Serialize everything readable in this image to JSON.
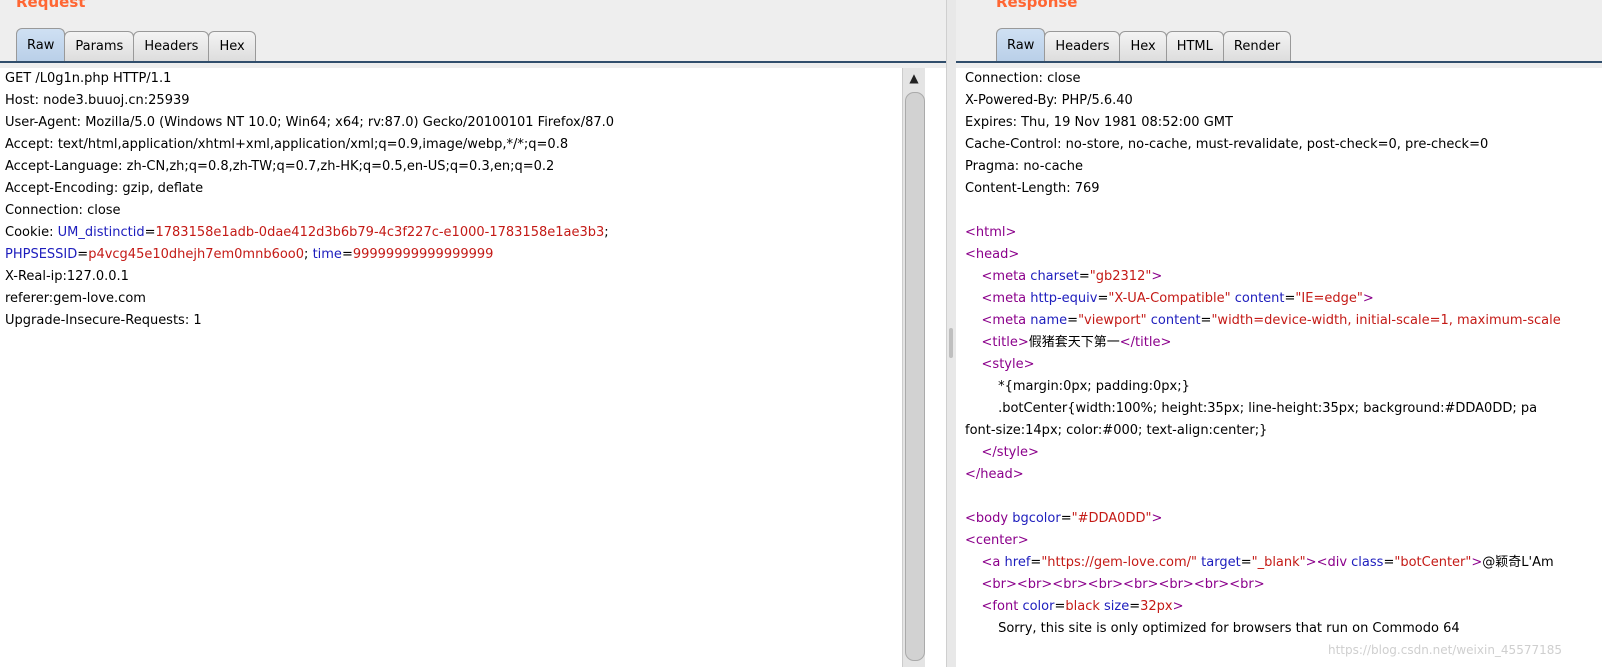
{
  "request": {
    "title": "Request",
    "tabs": [
      "Raw",
      "Params",
      "Headers",
      "Hex"
    ],
    "lines": [
      "GET /L0g1n.php HTTP/1.1",
      "Host: node3.buuoj.cn:25939",
      "User-Agent: Mozilla/5.0 (Windows NT 10.0; Win64; x64; rv:87.0) Gecko/20100101 Firefox/87.0",
      "Accept: text/html,application/xhtml+xml,application/xml;q=0.9,image/webp,*/*;q=0.8",
      "Accept-Language: zh-CN,zh;q=0.8,zh-TW;q=0.7,zh-HK;q=0.5,en-US;q=0.3,en;q=0.2",
      "Accept-Encoding: gzip, deflate",
      "Connection: close"
    ],
    "cookie": {
      "label": "Cookie: ",
      "um_name": "UM_distinctid",
      "um_value": "1783158e1adb-0dae412d3b6b79-4c3f227c-e1000-1783158e1ae3b3",
      "sep": ";",
      "sess_name": "PHPSESSID",
      "sess_value": "p4vcg45e10dhejh7em0mnb6oo0",
      "sep2": "; ",
      "time_name": "time",
      "time_value": "99999999999999999"
    },
    "lines_after": [
      "X-Real-ip:127.0.0.1",
      "referer:gem-love.com",
      "Upgrade-Insecure-Requests: 1"
    ]
  },
  "response": {
    "title": "Response",
    "tabs": [
      "Raw",
      "Headers",
      "Hex",
      "HTML",
      "Render"
    ],
    "headers": [
      "Connection: close",
      "X-Powered-By: PHP/5.6.40",
      "Expires: Thu, 19 Nov 1981 08:52:00 GMT",
      "Cache-Control: no-store, no-cache, must-revalidate, post-check=0, pre-check=0",
      "Pragma: no-cache",
      "Content-Length: 769"
    ],
    "html": {
      "html_open": "<html>",
      "head_open": "<head>",
      "meta1_tag": "<meta",
      "meta1_attr": "charset",
      "meta1_val": "\"gb2312\"",
      "meta1_end": ">",
      "meta2_attr1": "http-equiv",
      "meta2_val1": "\"X-UA-Compatible\"",
      "meta2_attr2": "content",
      "meta2_val2": "\"IE=edge\"",
      "meta3_attr1": "name",
      "meta3_val1": "\"viewport\"",
      "meta3_attr2": "content",
      "meta3_val2": "\"width=device-width, initial-scale=1, maximum-scale",
      "title_open": "<title>",
      "title_text": "假猪套天下第一",
      "title_close": "</title>",
      "style_open": "<style>",
      "style_line1": "*{margin:0px; padding:0px;}",
      "style_line2": ".botCenter{width:100%; height:35px; line-height:35px; background:#DDA0DD; pa",
      "style_line3": "font-size:14px; color:#000; text-align:center;}",
      "style_close": "</style>",
      "head_close": "</head>",
      "body_tag": "<body",
      "body_attr": "bgcolor",
      "body_val": "\"#DDA0DD\"",
      "center_open": "<center>",
      "a_tag": "<a",
      "a_attr1": "href",
      "a_val1": "\"https://gem-love.com/\"",
      "a_attr2": "target",
      "a_val2": "\"_blank\"",
      "div_tag": "<div",
      "div_attr": "class",
      "div_val": "\"botCenter\"",
      "div_text": "@颖奇L'Am",
      "br_line": "<br><br><br><br><br><br><br><br>",
      "font_tag": "<font",
      "font_attr1": "color",
      "font_val1": "black",
      "font_attr2": "size",
      "font_val2": "32px",
      "sorry_text": "Sorry, this site is only optimized for browsers that run on Commodo 64"
    }
  },
  "watermark": "https://blog.csdn.net/weixin_45577185",
  "icons": {
    "scroll_up": "▲"
  }
}
